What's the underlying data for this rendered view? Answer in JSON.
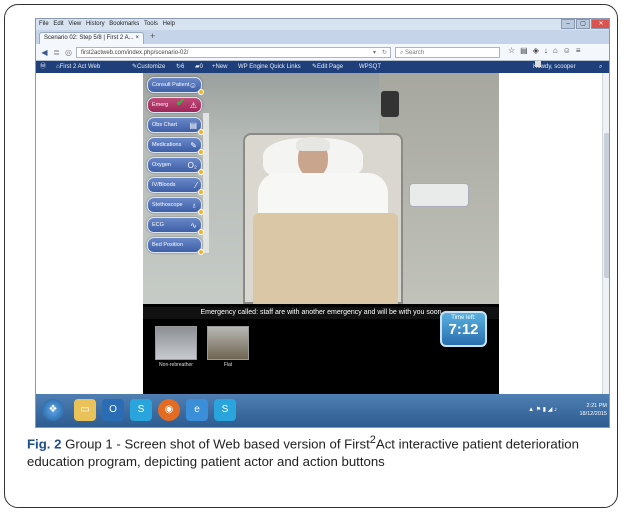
{
  "browser": {
    "menu": [
      "File",
      "Edit",
      "View",
      "History",
      "Bookmarks",
      "Tools",
      "Help"
    ],
    "tab_title": "Scenario 02: Step 5/8 | First 2 A...",
    "url": "first2actweb.com/index.php/scenario-02/",
    "search_placeholder": "Search"
  },
  "wp_admin_bar": {
    "site_name": "First 2 Act Web",
    "customize": "Customize",
    "updates": "6",
    "comments": "0",
    "new": "New",
    "quick_links": "WP Engine Quick Links",
    "edit_page": "Edit Page",
    "wpsqt": "WPSQT",
    "howdy": "Howdy, scooper"
  },
  "actions": [
    {
      "label": "Consult Patient",
      "icon": "user-icon"
    },
    {
      "label": "Emerg",
      "icon": "warning-icon"
    },
    {
      "label": "Obs Chart",
      "icon": "chart-icon"
    },
    {
      "label": "Medications",
      "icon": "pill-icon"
    },
    {
      "label": "Oxygen",
      "icon": "o2-icon"
    },
    {
      "label": "IV/Bloods",
      "icon": "syringe-icon"
    },
    {
      "label": "Stethoscope",
      "icon": "stethoscope-icon"
    },
    {
      "label": "ECG",
      "icon": "ecg-icon"
    },
    {
      "label": "Bed Position",
      "icon": "bed-icon"
    }
  ],
  "scenario": {
    "message": "Emergency called: staff are with another emergency and will be with you soon",
    "timer_label": "Time left:",
    "timer_value": "7:12",
    "options": [
      {
        "label": "Non-rebreather"
      },
      {
        "label": "Flat"
      }
    ]
  },
  "taskbar": {
    "time": "2:21 PM",
    "date": "18/12/2015"
  },
  "caption": {
    "fig_label": "Fig. 2",
    "text_before": "Group 1 - Screen shot of Web based version of First",
    "superscript": "2",
    "text_after": "Act interactive patient deterioration education program, depicting patient actor and action buttons"
  }
}
